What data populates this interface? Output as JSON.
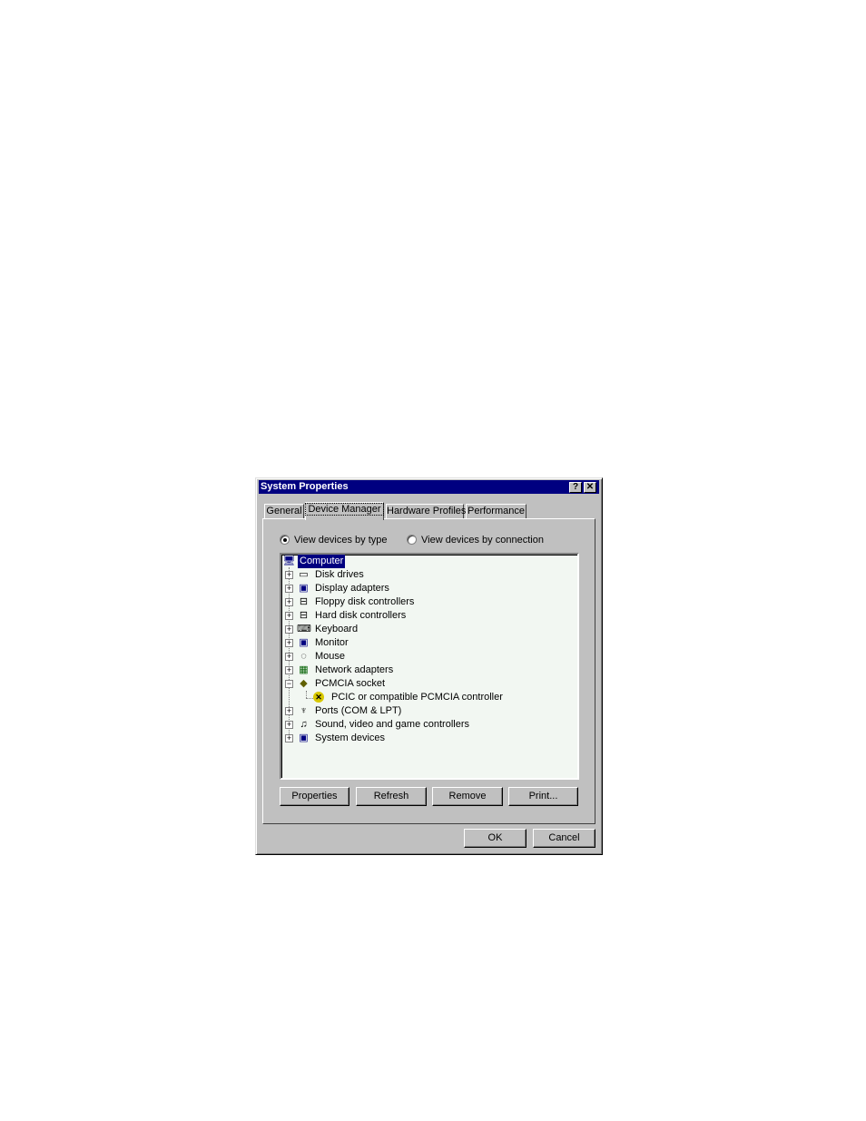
{
  "window": {
    "title": "System Properties",
    "help_button": "?",
    "close_button": "✕"
  },
  "tabs": [
    {
      "label": "General"
    },
    {
      "label": "Device Manager"
    },
    {
      "label": "Hardware Profiles"
    },
    {
      "label": "Performance"
    }
  ],
  "view_options": {
    "by_type": "View devices by type",
    "by_connection": "View devices by connection",
    "selected": "by_type"
  },
  "tree": {
    "root": {
      "label": "Computer",
      "icon": "computer-icon"
    },
    "items": [
      {
        "label": "Disk drives",
        "icon": "disk-drive-icon",
        "expander": "+"
      },
      {
        "label": "Display adapters",
        "icon": "display-adapter-icon",
        "expander": "+"
      },
      {
        "label": "Floppy disk controllers",
        "icon": "floppy-controller-icon",
        "expander": "+"
      },
      {
        "label": "Hard disk controllers",
        "icon": "hard-disk-controller-icon",
        "expander": "+"
      },
      {
        "label": "Keyboard",
        "icon": "keyboard-icon",
        "expander": "+"
      },
      {
        "label": "Monitor",
        "icon": "monitor-icon",
        "expander": "+"
      },
      {
        "label": "Mouse",
        "icon": "mouse-icon",
        "expander": "+"
      },
      {
        "label": "Network adapters",
        "icon": "network-adapter-icon",
        "expander": "+"
      },
      {
        "label": "PCMCIA socket",
        "icon": "pcmcia-icon",
        "expander": "−"
      },
      {
        "label": "PCIC or compatible PCMCIA controller",
        "icon": "disabled-device-icon",
        "child": true
      },
      {
        "label": "Ports (COM & LPT)",
        "icon": "port-icon",
        "expander": "+"
      },
      {
        "label": "Sound, video and game controllers",
        "icon": "sound-controller-icon",
        "expander": "+"
      },
      {
        "label": "System devices",
        "icon": "system-devices-icon",
        "expander": "+"
      }
    ]
  },
  "buttons": {
    "properties": "Properties",
    "refresh": "Refresh",
    "remove": "Remove",
    "print": "Print...",
    "ok": "OK",
    "cancel": "Cancel"
  },
  "colors": {
    "titlebar": "#000080",
    "face": "#c0c0c0",
    "selection": "#000080"
  }
}
